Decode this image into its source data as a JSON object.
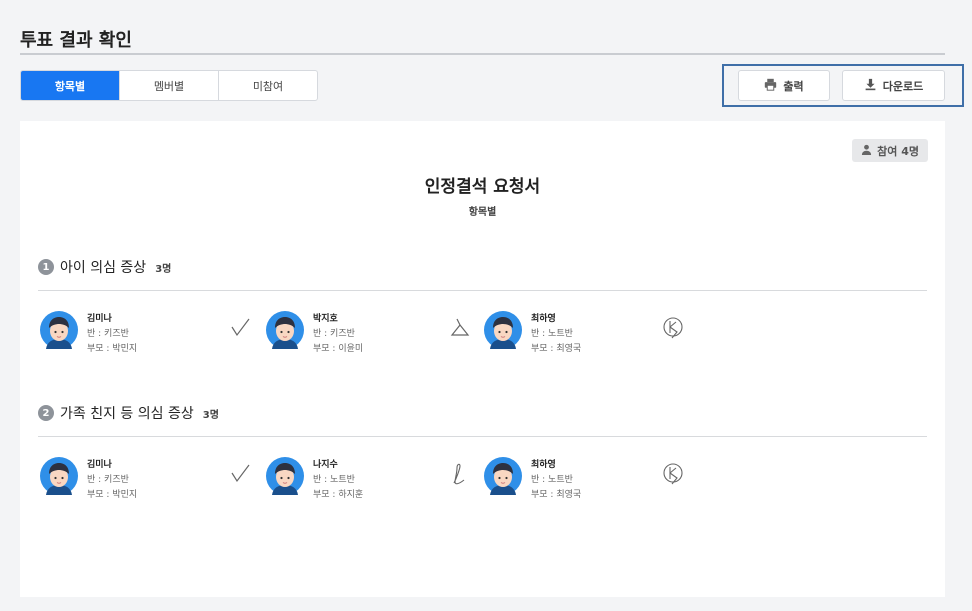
{
  "header": {
    "title": "투표 결과 확인"
  },
  "tabs": [
    {
      "label": "항목별",
      "active": true
    },
    {
      "label": "멤버별",
      "active": false
    },
    {
      "label": "미참여",
      "active": false
    }
  ],
  "actions": {
    "print_label": "출력",
    "download_label": "다운로드"
  },
  "document": {
    "participants_badge": "참여 4명",
    "title": "인정결석 요청서",
    "subtitle": "항목별"
  },
  "sections": [
    {
      "number": "1",
      "title": "아이 의심 증상",
      "count": "3명",
      "members": [
        {
          "name": "김미나",
          "class_line": "반 : 키즈반",
          "parent_line": "부모 : 박민지",
          "signature": "check-signature"
        },
        {
          "name": "박지호",
          "class_line": "반 : 키즈반",
          "parent_line": "부모 : 이윤미",
          "signature": "triangle-signature"
        },
        {
          "name": "최하영",
          "class_line": "반 : 노트반",
          "parent_line": "부모 : 최영국",
          "signature": "circle-k-signature"
        }
      ]
    },
    {
      "number": "2",
      "title": "가족 친지 등 의심 증상",
      "count": "3명",
      "members": [
        {
          "name": "김미나",
          "class_line": "반 : 키즈반",
          "parent_line": "부모 : 박민지",
          "signature": "check-signature"
        },
        {
          "name": "나지수",
          "class_line": "반 : 노트반",
          "parent_line": "부모 : 하지훈",
          "signature": "loop-signature"
        },
        {
          "name": "최하영",
          "class_line": "반 : 노트반",
          "parent_line": "부모 : 최영국",
          "signature": "circle-k-signature"
        }
      ]
    }
  ],
  "colors": {
    "accent": "#1877f2",
    "highlight_border": "#3f6fa8",
    "avatar_bg": "#2f8fe8"
  }
}
